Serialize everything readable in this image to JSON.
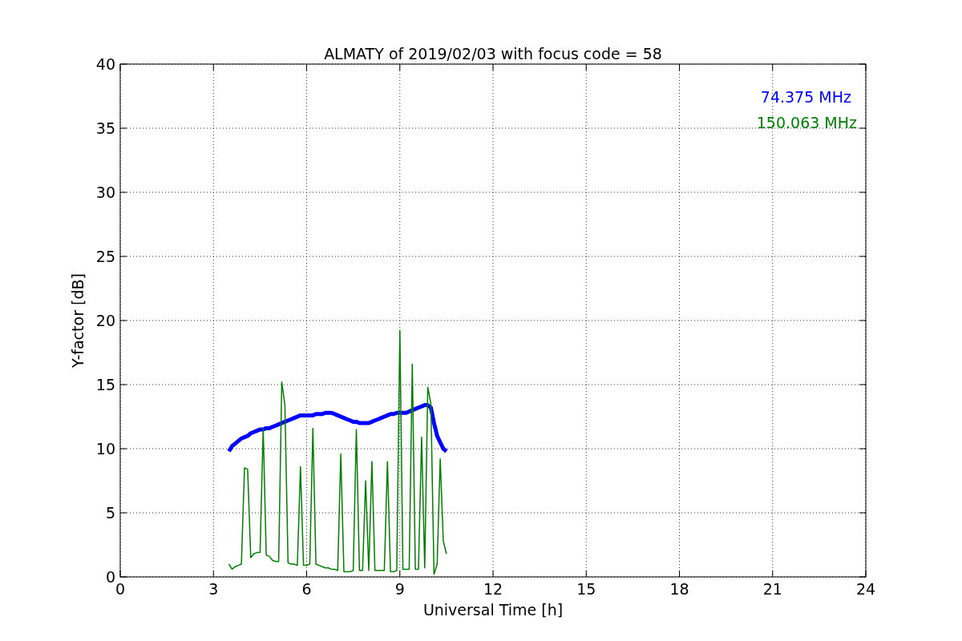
{
  "chart_data": {
    "type": "line",
    "title": "ALMATY of 2019/02/03 with focus code = 58",
    "xlabel": "Universal Time [h]",
    "ylabel": "Y-factor [dB]",
    "x": [
      3.5,
      3.6,
      3.7,
      3.8,
      3.9,
      4.0,
      4.1,
      4.2,
      4.3,
      4.4,
      4.5,
      4.6,
      4.7,
      4.8,
      4.9,
      5.0,
      5.1,
      5.2,
      5.3,
      5.4,
      5.5,
      5.6,
      5.7,
      5.8,
      5.9,
      6.0,
      6.1,
      6.2,
      6.3,
      6.4,
      6.5,
      6.6,
      6.7,
      6.8,
      6.9,
      7.0,
      7.1,
      7.2,
      7.3,
      7.4,
      7.5,
      7.6,
      7.7,
      7.8,
      7.9,
      8.0,
      8.1,
      8.2,
      8.3,
      8.4,
      8.5,
      8.6,
      8.7,
      8.8,
      8.9,
      9.0,
      9.1,
      9.2,
      9.3,
      9.4,
      9.5,
      9.6,
      9.7,
      9.8,
      9.9,
      10.0,
      10.1,
      10.2,
      10.3,
      10.4,
      10.5
    ],
    "series": [
      {
        "name": "74.375 MHz",
        "color": "#0000ff",
        "values": [
          9.8,
          10.2,
          10.4,
          10.6,
          10.8,
          10.9,
          11.0,
          11.2,
          11.3,
          11.4,
          11.5,
          11.5,
          11.6,
          11.6,
          11.7,
          11.8,
          11.9,
          12.0,
          12.1,
          12.2,
          12.3,
          12.4,
          12.5,
          12.6,
          12.6,
          12.6,
          12.6,
          12.6,
          12.7,
          12.7,
          12.7,
          12.8,
          12.8,
          12.8,
          12.7,
          12.6,
          12.5,
          12.4,
          12.3,
          12.2,
          12.1,
          12.1,
          12.0,
          12.0,
          12.0,
          12.0,
          12.1,
          12.2,
          12.3,
          12.4,
          12.5,
          12.6,
          12.7,
          12.7,
          12.8,
          12.8,
          12.8,
          12.8,
          12.9,
          13.0,
          13.1,
          13.2,
          13.3,
          13.4,
          13.4,
          13.2,
          12.0,
          11.0,
          10.5,
          10.0,
          9.8
        ]
      },
      {
        "name": "150.063 MHz",
        "color": "#008000",
        "values": [
          1.0,
          0.6,
          0.8,
          0.9,
          1.0,
          8.5,
          8.4,
          1.5,
          1.8,
          1.9,
          1.9,
          11.6,
          1.7,
          1.6,
          1.3,
          1.2,
          1.2,
          15.2,
          13.4,
          1.1,
          1.0,
          1.0,
          0.9,
          8.6,
          0.9,
          0.9,
          1.0,
          11.6,
          1.0,
          0.9,
          0.8,
          0.7,
          0.7,
          0.6,
          0.6,
          0.5,
          9.6,
          0.4,
          0.4,
          0.4,
          0.5,
          11.5,
          0.5,
          0.5,
          7.5,
          0.5,
          9.0,
          0.5,
          0.5,
          0.5,
          0.5,
          9.0,
          0.4,
          0.4,
          0.5,
          19.2,
          0.6,
          0.6,
          0.6,
          16.6,
          0.6,
          0.6,
          10.9,
          0.7,
          14.8,
          13.5,
          0.2,
          1.0,
          9.2,
          2.8,
          1.8
        ]
      }
    ],
    "xlim": [
      0,
      24
    ],
    "ylim": [
      0,
      40
    ],
    "xticks": [
      0,
      3,
      6,
      9,
      12,
      15,
      18,
      21,
      24
    ],
    "yticks": [
      0,
      5,
      10,
      15,
      20,
      25,
      30,
      35,
      40
    ],
    "grid": true
  }
}
